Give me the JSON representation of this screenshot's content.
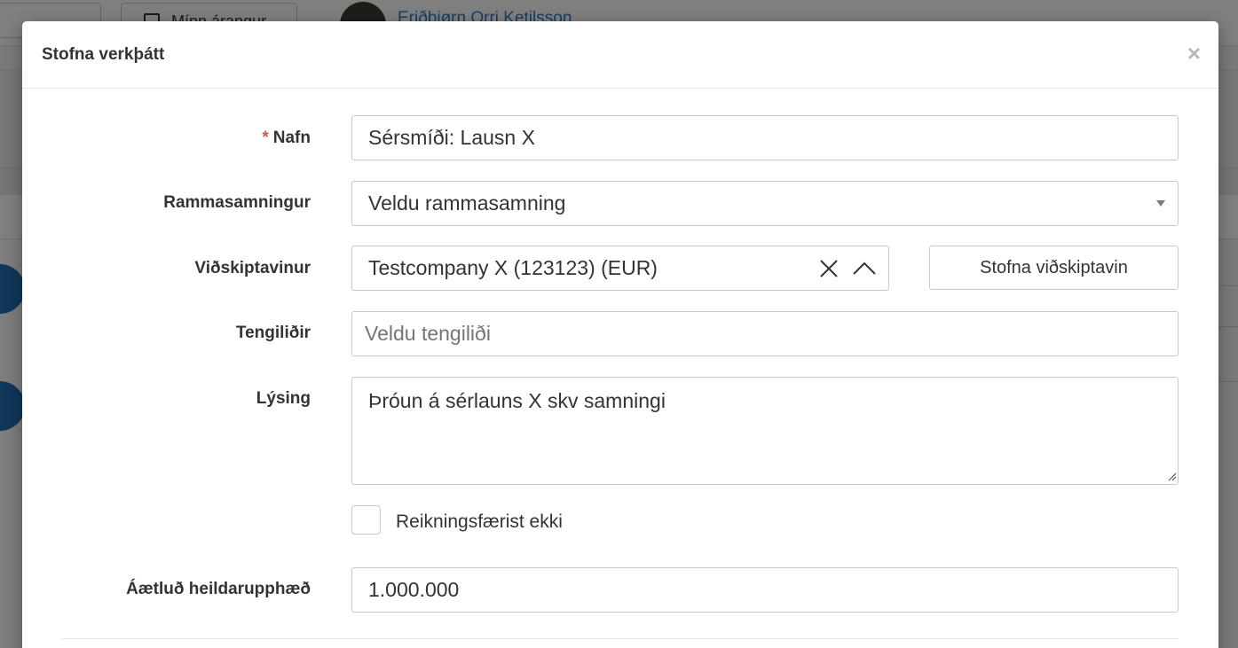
{
  "background": {
    "my_projects_button": "Mínn árangur",
    "user_name": "Eriðbjørn Orri Ketilsson"
  },
  "modal": {
    "title": "Stofna verkþátt",
    "close_symbol": "×"
  },
  "form": {
    "name": {
      "required_mark": "*",
      "label": "Nafn",
      "value": "Sérsmíði: Lausn X"
    },
    "framework": {
      "label": "Rammasamningur",
      "selected": "Veldu rammasamning"
    },
    "customer": {
      "label": "Viðskiptavinur",
      "selected": "Testcompany X (123123) (EUR)",
      "create_button": "Stofna viðskiptavin"
    },
    "contact": {
      "label": "Tengiliðir",
      "placeholder": "Veldu tengiliði"
    },
    "description": {
      "label": "Lýsing",
      "value": "Þróun á sérlauns X skv samningi"
    },
    "not_invoiced": {
      "label": "Reikningsfærist ekki",
      "checked": false
    },
    "estimated_total": {
      "label": "Áætluð heildarupphæð",
      "value": "1.000.000"
    }
  },
  "colors": {
    "accent_link": "#2f7fbf",
    "required": "#d9534f",
    "fab": "#1f6fb2"
  }
}
